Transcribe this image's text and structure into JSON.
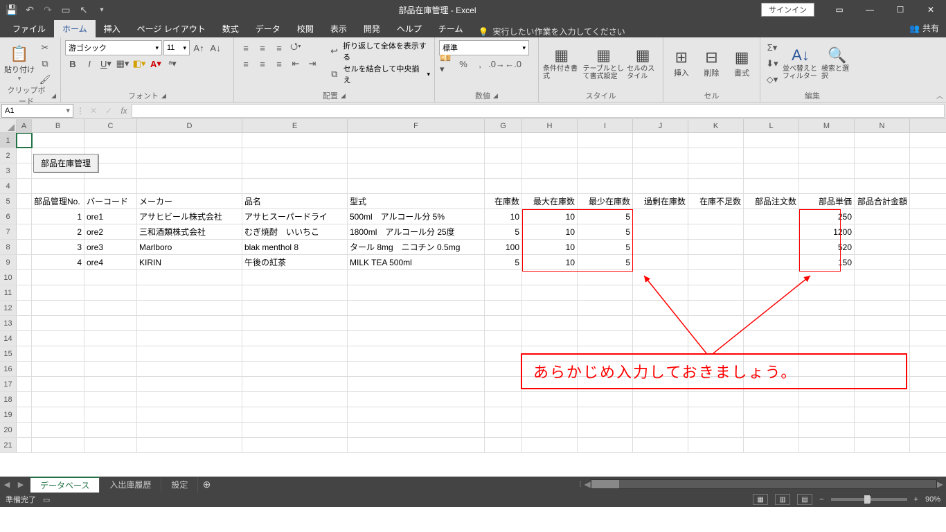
{
  "title": "部品在庫管理 - Excel",
  "signin": "サインイン",
  "tabs": {
    "file": "ファイル",
    "home": "ホーム",
    "insert": "挿入",
    "pagelayout": "ページ レイアウト",
    "formulas": "数式",
    "data": "データ",
    "review": "校閲",
    "view": "表示",
    "developer": "開発",
    "help": "ヘルプ",
    "team": "チーム"
  },
  "tell_me": "実行したい作業を入力してください",
  "share": "共有",
  "ribbon": {
    "clipboard_paste": "貼り付け",
    "clipboard_label": "クリップボード",
    "font_name": "游ゴシック",
    "font_size": "11",
    "font_label": "フォント",
    "wrap": "折り返して全体を表示する",
    "merge": "セルを結合して中央揃え",
    "align_label": "配置",
    "num_format": "標準",
    "num_label": "数値",
    "cond": "条件付き書式",
    "tablefmt": "テーブルとして書式設定",
    "cellstyle": "セルのスタイル",
    "style_label": "スタイル",
    "ins": "挿入",
    "del": "削除",
    "fmt": "書式",
    "cells_label": "セル",
    "sort": "並べ替えとフィルター",
    "find": "検索と選択",
    "edit_label": "編集"
  },
  "namebox": "A1",
  "columns": [
    "A",
    "B",
    "C",
    "D",
    "E",
    "F",
    "G",
    "H",
    "I",
    "J",
    "K",
    "L",
    "M",
    "N"
  ],
  "floating_button": "部品在庫管理",
  "headers": [
    "部品管理No.",
    "バーコード",
    "メーカー",
    "品名",
    "型式",
    "在庫数",
    "最大在庫数",
    "最少在庫数",
    "過剰在庫数",
    "在庫不足数",
    "部品注文数",
    "部品単価",
    "部品合計金額"
  ],
  "rows": [
    {
      "no": "1",
      "barcode": "ore1",
      "maker": "アサヒビール株式会社",
      "name": "アサヒスーパードライ",
      "model": "500ml　アルコール分 5%",
      "stock": "10",
      "max": "10",
      "min": "5",
      "price": "250"
    },
    {
      "no": "2",
      "barcode": "ore2",
      "maker": "三和酒類株式会社",
      "name": "むぎ焼酎　いいちこ",
      "model": "1800ml　アルコール分 25度",
      "stock": "5",
      "max": "10",
      "min": "5",
      "price": "1200"
    },
    {
      "no": "3",
      "barcode": "ore3",
      "maker": "Marlboro",
      "name": "blak menthol 8",
      "model": "タール 8mg　ニコチン 0.5mg",
      "stock": "100",
      "max": "10",
      "min": "5",
      "price": "520"
    },
    {
      "no": "4",
      "barcode": "ore4",
      "maker": "KIRIN",
      "name": "午後の紅茶",
      "model": "MILK TEA 500ml",
      "stock": "5",
      "max": "10",
      "min": "5",
      "price": "150"
    }
  ],
  "annotation": "あらかじめ入力しておきましょう。",
  "sheets": {
    "active": "データベース",
    "s2": "入出庫履歴",
    "s3": "設定"
  },
  "status": {
    "ready": "準備完了",
    "zoom": "90%"
  }
}
